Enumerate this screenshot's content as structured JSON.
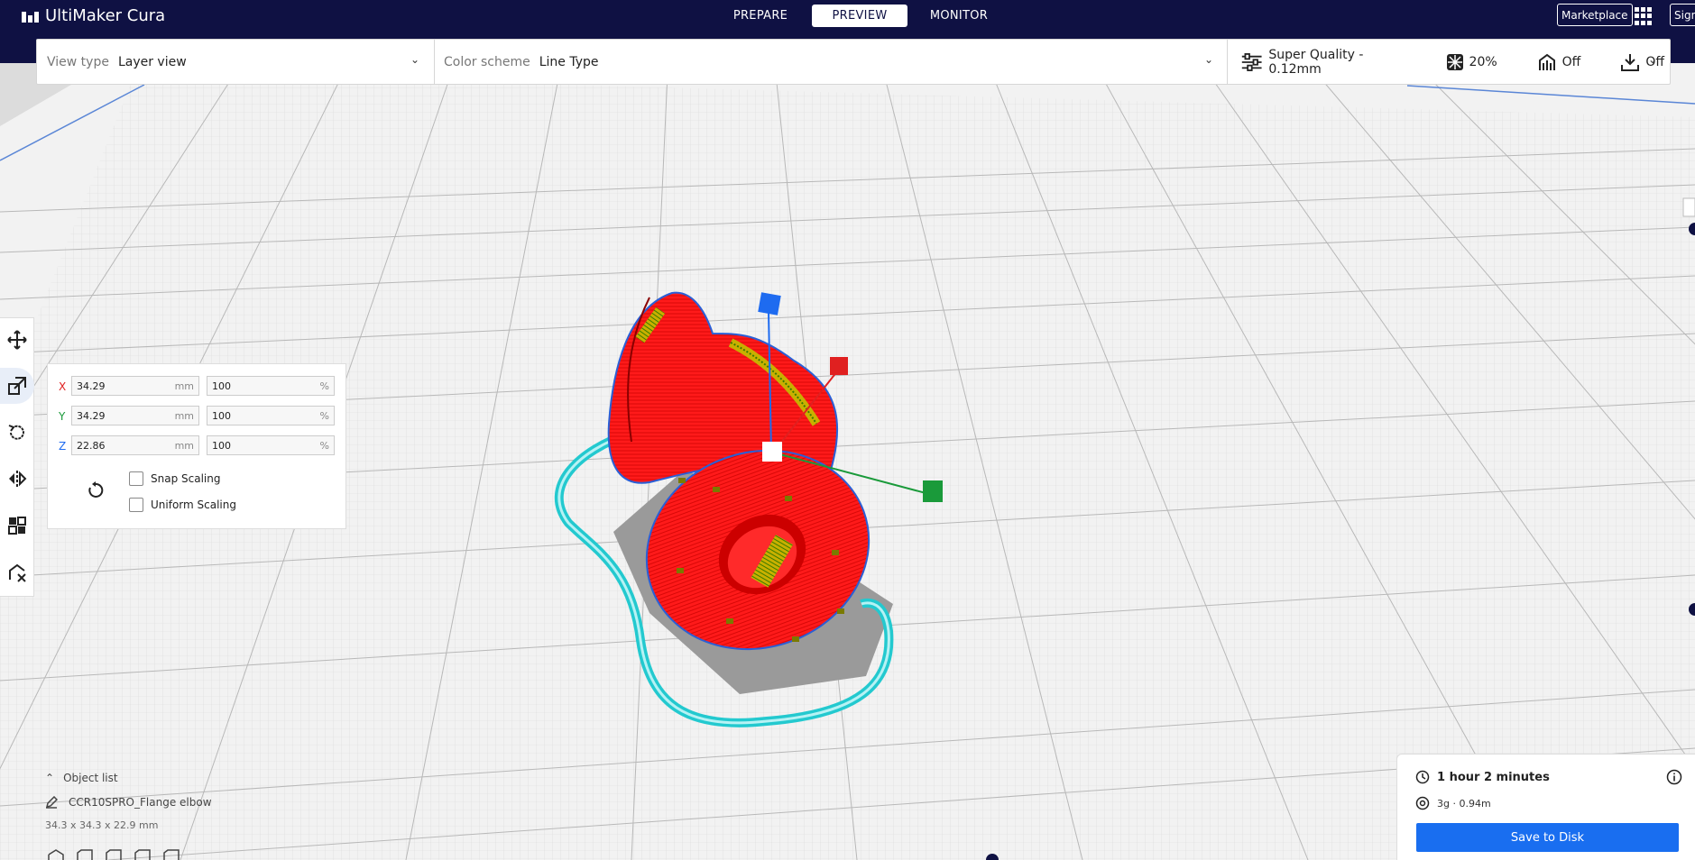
{
  "app": {
    "title": "UltiMaker Cura"
  },
  "tabs": [
    {
      "label": "PREPARE",
      "active": false
    },
    {
      "label": "PREVIEW",
      "active": true
    },
    {
      "label": "MONITOR",
      "active": false
    }
  ],
  "header": {
    "marketplace_label": "Marketplace",
    "signin_label": "Sign"
  },
  "settings": {
    "view_type_label": "View type",
    "view_type_value": "Layer view",
    "color_scheme_label": "Color scheme",
    "color_scheme_value": "Line Type",
    "quality": "Super Quality - 0.12mm",
    "infill": "20%",
    "support": "Off",
    "adhesion": "Off"
  },
  "scale": {
    "x_label": "X",
    "x_mm": "34.29",
    "x_pct": "100",
    "y_label": "Y",
    "y_mm": "34.29",
    "y_pct": "100",
    "z_label": "Z",
    "z_mm": "22.86",
    "z_pct": "100",
    "unit_mm": "mm",
    "unit_pct": "%",
    "snap_label": "Snap Scaling",
    "uniform_label": "Uniform Scaling"
  },
  "object_list": {
    "header": "Object list",
    "item_name": "CCR10SPRO_Flange elbow",
    "dimensions": "34.3 x 34.3 x 22.9 mm"
  },
  "print": {
    "time": "1 hour 2 minutes",
    "material": "3g · 0.94m",
    "save_label": "Save to Disk"
  },
  "colors": {
    "header_bg": "#0f1143",
    "accent": "#196ef0",
    "model": "#ff0000",
    "skirt": "#1fd3d3",
    "axis_x": "#e02020",
    "axis_y": "#1a9a3a",
    "axis_z": "#1e6bf0"
  },
  "icons": [
    "move-icon",
    "scale-icon",
    "rotate-icon",
    "mirror-icon",
    "per-model-settings-icon",
    "support-blocker-icon",
    "clock-icon",
    "info-icon",
    "spool-icon",
    "pencil-icon",
    "chevron-up-icon",
    "reset-icon"
  ]
}
